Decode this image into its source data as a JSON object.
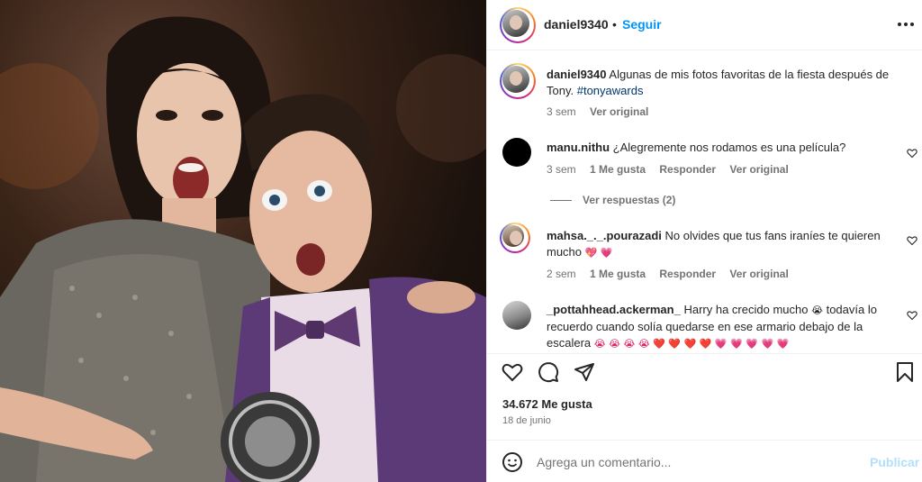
{
  "post": {
    "username": "daniel9340",
    "dot": "•",
    "follow_label": "Seguir",
    "caption_user": "daniel9340",
    "caption_text": "Algunas de mis fotos favoritas de la fiesta después de Tony.",
    "caption_tag": "#tonyawards",
    "caption_time": "3 sem",
    "caption_translate": "Ver original",
    "likes": "34.672 Me gusta",
    "date": "18 de junio",
    "comment_placeholder": "Agrega un comentario...",
    "publish_label": "Publicar"
  },
  "comments": [
    {
      "user": "manu.nithu",
      "text": "¿Alegremente nos rodamos es una película?",
      "time": "3 sem",
      "likes": "1 Me gusta",
      "reply": "Responder",
      "translate": "Ver original",
      "view_replies": "Ver respuestas (2)"
    },
    {
      "user": "mahsa._._.pourazadi",
      "text": "No olvides que tus fans iraníes te quieren mucho",
      "emoji": "💖 💗",
      "time": "2 sem",
      "likes": "1 Me gusta",
      "reply": "Responder",
      "translate": "Ver original"
    },
    {
      "user": "_pottahhead.ackerman_",
      "text_a": "Harry ha crecido mucho",
      "emoji_a": "😭",
      "text_b": "todavía lo recuerdo cuando solía quedarse en ese armario debajo de la escalera",
      "emoji_b": "😭 😭 😭 😭 ❤️ ❤️ ❤️  ❤️ 💗 💗 💗 💗 💗"
    }
  ],
  "colors": {
    "link": "#00376b",
    "follow": "#0095f6",
    "meta": "#737373",
    "publish_disabled": "#b2dffc"
  },
  "icons": [
    "more-icon",
    "heart-icon",
    "comment-icon",
    "share-icon",
    "bookmark-icon",
    "emoji-icon"
  ]
}
